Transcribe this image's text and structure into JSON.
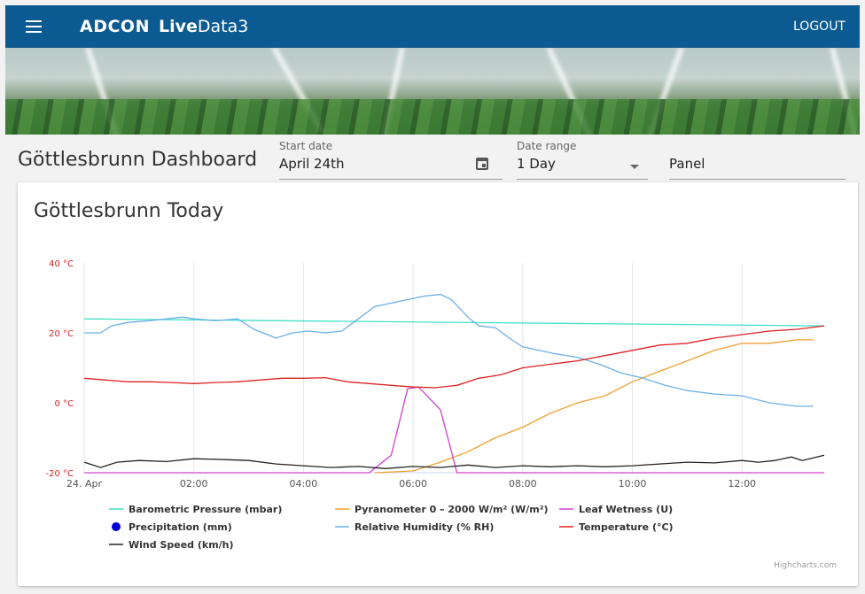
{
  "app": {
    "brand": "ADCON",
    "product_bold": "Live",
    "product_rest": "Data3",
    "logout_label": "LOGOUT",
    "menu_icon": "hamburger-menu-icon"
  },
  "dashboard": {
    "title": "Göttlesbrunn Dashboard"
  },
  "filters": {
    "start_date": {
      "label": "Start date",
      "value": "April 24th",
      "icon": "calendar-icon"
    },
    "date_range": {
      "label": "Date range",
      "value": "1 Day",
      "icon": "dropdown-arrow-icon"
    },
    "panel": {
      "placeholder": "Panel"
    }
  },
  "card": {
    "title": "Göttlesbrunn Today",
    "credits": "Highcharts.com"
  },
  "chart_data": {
    "type": "line",
    "x_unit": "hours since 24. Apr 00:00",
    "x_range": [
      0,
      13.5
    ],
    "x_ticks": [
      0,
      2,
      4,
      6,
      8,
      10,
      12
    ],
    "x_tick_labels": [
      "24. Apr",
      "02:00",
      "04:00",
      "06:00",
      "08:00",
      "10:00",
      "12:00"
    ],
    "y_range": [
      -20,
      40
    ],
    "y_ticks": [
      -20,
      0,
      20,
      40
    ],
    "y_tick_labels": [
      "-20 °C",
      "0 °C",
      "20 °C",
      "40 °C"
    ],
    "axis_color": "#cc2222",
    "grid": "vertical",
    "legend_position": "bottom",
    "series": [
      {
        "name": "Barometric Pressure (mbar)",
        "color": "#40e0c8",
        "marker": "line",
        "x": [
          0,
          13.5
        ],
        "y": [
          24,
          22
        ]
      },
      {
        "name": "Pyranometer 0 – 2000 W/m² (W/m²)",
        "color": "#f0a030",
        "marker": "line",
        "x": [
          5.3,
          6.0,
          6.5,
          7.0,
          7.5,
          8.0,
          8.5,
          9.0,
          9.5,
          10.0,
          10.5,
          11.0,
          11.5,
          12.0,
          12.5,
          13.0,
          13.3
        ],
        "y": [
          -20,
          -19.5,
          -17,
          -14,
          -10,
          -7,
          -3,
          0,
          2,
          6,
          9,
          12,
          15,
          17,
          17,
          18,
          18
        ]
      },
      {
        "name": "Leaf Wetness (U)",
        "color": "#d040d0",
        "marker": "line",
        "x": [
          0,
          5.2,
          5.6,
          5.9,
          6.1,
          6.5,
          6.8,
          13.5
        ],
        "y": [
          -20,
          -20,
          -15,
          4,
          4.5,
          -2,
          -20,
          -20
        ]
      },
      {
        "name": "Precipitation (mm)",
        "color": "#0000dd",
        "marker": "dot",
        "x": [],
        "y": []
      },
      {
        "name": "Relative Humidity (% RH)",
        "color": "#6ab0e8",
        "marker": "line",
        "x": [
          0,
          0.3,
          0.5,
          0.8,
          1.2,
          1.5,
          1.8,
          2.0,
          2.4,
          2.8,
          3.1,
          3.5,
          3.8,
          4.1,
          4.4,
          4.7,
          5.0,
          5.3,
          5.6,
          5.9,
          6.2,
          6.5,
          6.7,
          7.0,
          7.2,
          7.5,
          7.8,
          8.0,
          8.3,
          8.6,
          9.0,
          9.4,
          9.8,
          10.2,
          10.6,
          11.0,
          11.5,
          12.0,
          12.5,
          13.0,
          13.3
        ],
        "y": [
          20,
          20,
          22,
          23,
          23.5,
          24,
          24.5,
          24,
          23.5,
          24,
          21,
          18.5,
          20,
          20.5,
          20,
          20.5,
          24,
          27.5,
          28.5,
          29.5,
          30.5,
          31,
          29.5,
          24.5,
          22,
          21.5,
          18,
          16,
          15,
          14,
          13,
          11,
          8.5,
          7,
          5,
          3.5,
          2.5,
          2,
          0,
          -1,
          -1
        ]
      },
      {
        "name": "Temperature (°C)",
        "color": "#dd2222",
        "marker": "line",
        "x": [
          0,
          0.4,
          0.8,
          1.2,
          1.6,
          2.0,
          2.4,
          2.8,
          3.2,
          3.6,
          4.0,
          4.4,
          4.8,
          5.2,
          5.6,
          6.0,
          6.4,
          6.8,
          7.2,
          7.6,
          8.0,
          8.5,
          9.0,
          9.5,
          10.0,
          10.5,
          11.0,
          11.5,
          12.0,
          12.5,
          13.0,
          13.5
        ],
        "y": [
          7,
          6.5,
          6,
          6,
          5.8,
          5.5,
          5.8,
          6,
          6.5,
          7,
          7,
          7.2,
          6,
          5.5,
          5,
          4.5,
          4.3,
          5,
          7,
          8,
          10,
          11,
          12,
          13.5,
          15,
          16.5,
          17,
          18.5,
          19.5,
          20.5,
          21,
          22
        ]
      },
      {
        "name": "Wind Speed (km/h)",
        "color": "#222222",
        "marker": "line",
        "x": [
          0,
          0.3,
          0.6,
          1.0,
          1.5,
          2.0,
          2.5,
          3.0,
          3.5,
          4.0,
          4.5,
          5.0,
          5.5,
          6.0,
          6.5,
          7.0,
          7.5,
          8.0,
          8.5,
          9.0,
          9.5,
          10.0,
          10.5,
          11.0,
          11.5,
          12.0,
          12.3,
          12.6,
          12.9,
          13.1,
          13.5
        ],
        "y": [
          -17,
          -18.5,
          -17,
          -16.5,
          -16.8,
          -16,
          -16.2,
          -16.5,
          -17.5,
          -18,
          -18.5,
          -18.2,
          -18.8,
          -18.2,
          -18.5,
          -17.8,
          -18.5,
          -18,
          -18.3,
          -18,
          -18.3,
          -18,
          -17.5,
          -17,
          -17.2,
          -16.5,
          -17,
          -16.5,
          -15.5,
          -16.5,
          -15
        ]
      }
    ]
  }
}
